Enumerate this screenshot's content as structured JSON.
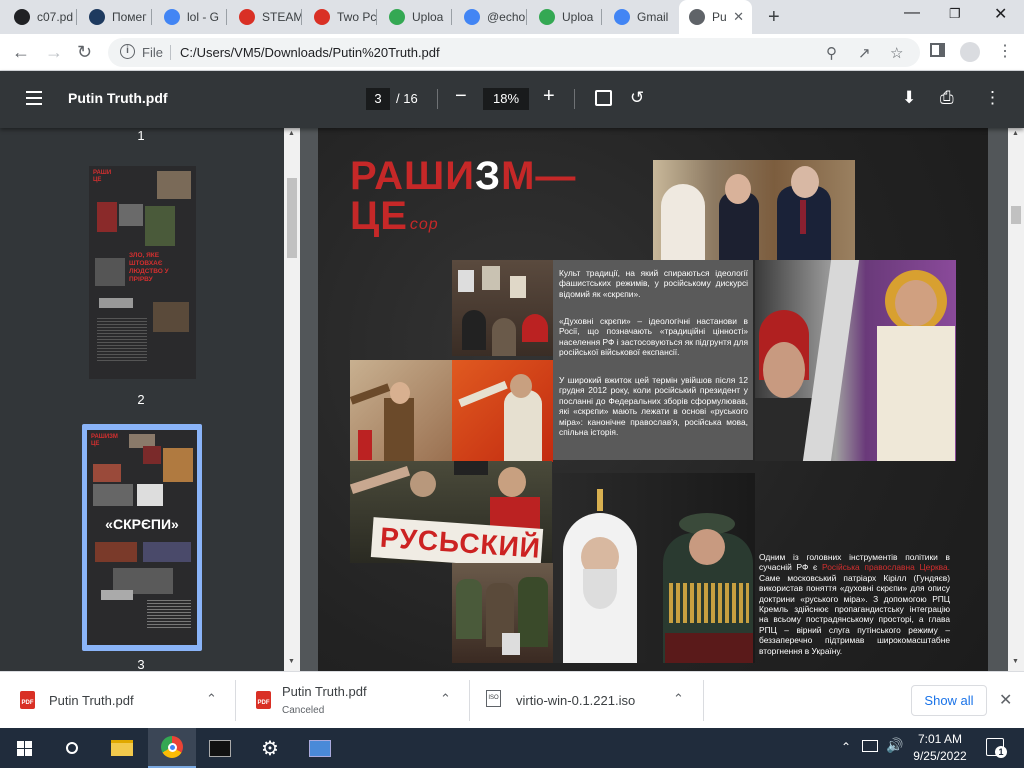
{
  "tabs": [
    {
      "label": "c07.pd",
      "color": "#202124"
    },
    {
      "label": "Помег",
      "color": "#1e3a5f"
    },
    {
      "label": "lol - G",
      "color": "#4285f4"
    },
    {
      "label": "STEAM",
      "color": "#d93025"
    },
    {
      "label": "Two Pc",
      "color": "#d93025"
    },
    {
      "label": "Uploa",
      "color": "#34a853"
    },
    {
      "label": "@echo",
      "color": "#4285f4"
    },
    {
      "label": "Uploa",
      "color": "#34a853"
    },
    {
      "label": "Gmail",
      "color": "#4285f4"
    },
    {
      "label": "Pu",
      "color": "#5f6368"
    }
  ],
  "address": {
    "scheme_label": "File",
    "url": "C:/Users/VM5/Downloads/Putin%20Truth.pdf"
  },
  "pdf": {
    "title": "Putin Truth.pdf",
    "current_page": "3",
    "total_pages": "/ 16",
    "zoom": "18%"
  },
  "thumbnails": [
    {
      "label": "1"
    },
    {
      "label": "2",
      "text": "ЗЛО, ЯКЕ ШТОВХАЄ ЛЮДСТВО У ПРІРВУ"
    },
    {
      "label": "3",
      "text": "«СКРЄПИ»"
    }
  ],
  "page_content": {
    "title_part1": "РАШИ",
    "title_z": "З",
    "title_part2": "М—",
    "title_line2": "ЦЕ",
    "title_suffix": "сор",
    "para1": "Культ традиції, на який спираються ідеології фашистських режимів, у російському дискурсі відомий як «скрєпи».",
    "para2": "«Духовні скрєпи» – ідеологічні настанови в Росії, що позначають «традиційні цінності» населення РФ і застосовуються як підгрунтя для російської військової експансії.",
    "para3": "У широкий вжиток цей термін увійшов після 12 грудня 2012 року, коли російський президент у посланні до Федеральних зборів сформулював, які «скрєпи» мають лежати в основі «руського міра»: канонічне православ'я, російська мова, спільна історія.",
    "para4_a": "Одним із головних інструментів політики в сучасній РФ є ",
    "para4_red": "Російська православна Церква.",
    "para4_b": " Саме московський патріарх Кірілл (Гундяєв) використав поняття «духовні скрєпи» для опису доктрини «руського міра». З допомогою РПЦ Кремль здійснює пропагандистську інтеграцію на всьому пострадянському просторі, а глава РПЦ – вірний слуга путінського режиму – беззаперечно підтримав широкомасштабне вторгнення в Україну.",
    "banner_text": "РУСЬСКИЙ"
  },
  "downloads": [
    {
      "name": "Putin Truth.pdf",
      "status": ""
    },
    {
      "name": "Putin Truth.pdf",
      "status": "Canceled"
    },
    {
      "name": "virtio-win-0.1.221.iso",
      "status": ""
    }
  ],
  "show_all": "Show all",
  "clock": {
    "time": "7:01 AM",
    "date": "9/25/2022"
  },
  "notification_count": "1"
}
